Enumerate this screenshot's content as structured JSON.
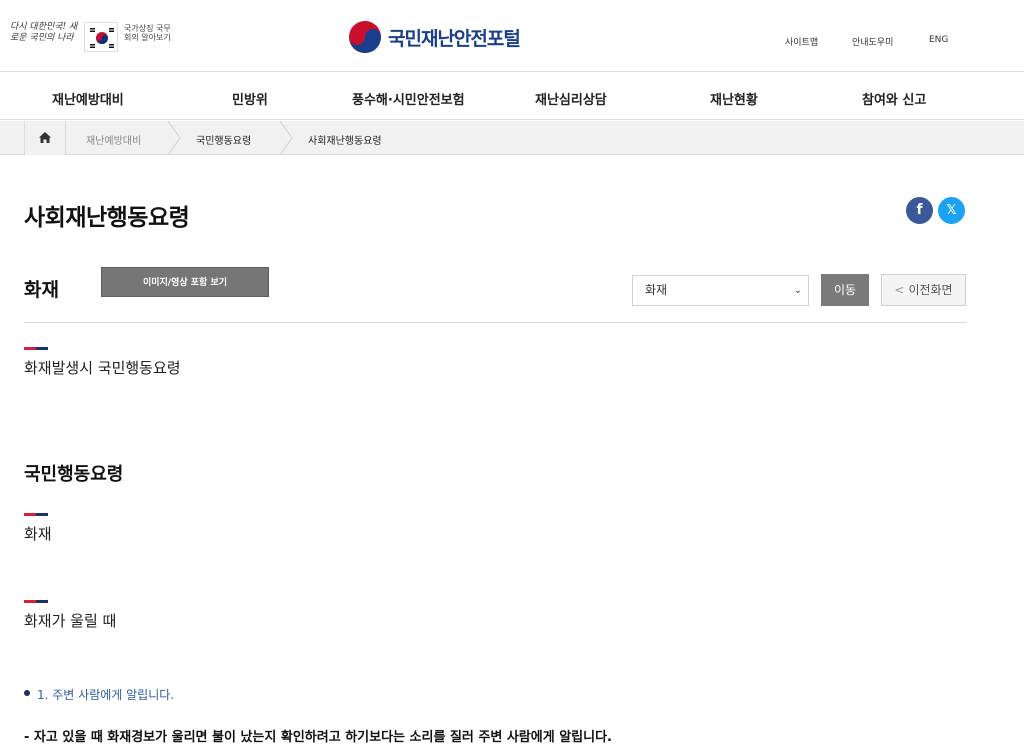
{
  "header": {
    "slogan": "다시 대한민국! 새로운 국민의 나라",
    "gov_symbol_text": "국가상징 국무회의 알아보기",
    "logo_text": "국민재난안전포털",
    "utility_links": [
      "사이트맵",
      "안내도우미",
      "ENG"
    ]
  },
  "nav": {
    "items": [
      "재난예방대비",
      "민방위",
      "풍수해·시민안전보험",
      "재난심리상담",
      "재난현황",
      "참여와 신고"
    ]
  },
  "breadcrumb": {
    "items": [
      "재난예방대비",
      "국민행동요령",
      "사회재난행동요령"
    ]
  },
  "page": {
    "title": "사회재난행동요령",
    "section_title": "화재",
    "media_button": "이미지/영상 포함 보기",
    "select_value": "화재",
    "go_button": "이동",
    "back_button": "이전화면",
    "back_glyph": "<",
    "fb_glyph": "f",
    "x_glyph": "𝕏"
  },
  "content": {
    "subhead_1": "화재발생시 국민행동요령",
    "heading_2": "국민행동요령",
    "subhead_2": "화재",
    "subhead_3": "화재가 울릴 때",
    "bullet_1": "1. 주변 사람에게 알립니다.",
    "body_1": "- 자고 있을 때 화재경보가 울리면 불이 났는지 확인하려고 하기보다는 소리를 질러 주변 사람에게 알립니다."
  },
  "colors": {
    "accent_red": "#d6203a",
    "accent_navy": "#1a2f6b",
    "facebook": "#3b5998",
    "x_blue": "#1da1f2",
    "logo_blue": "#1a3e8c"
  }
}
